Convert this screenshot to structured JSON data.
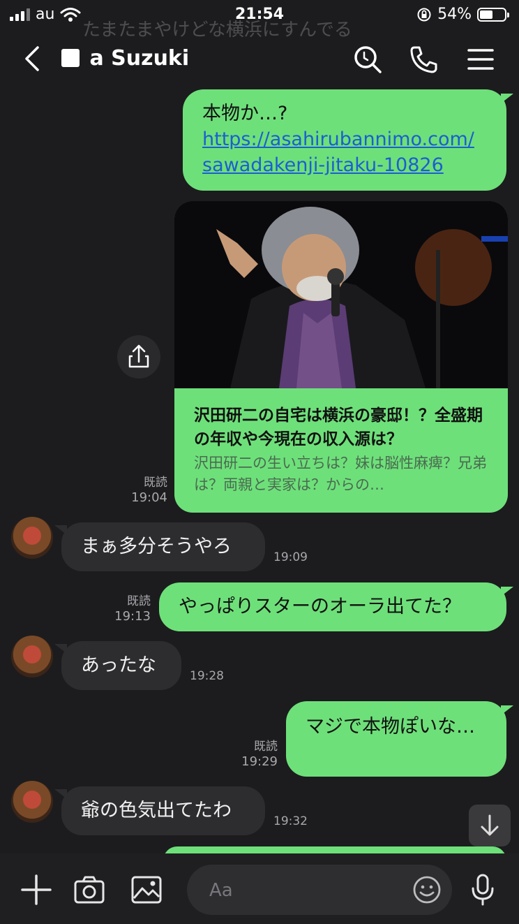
{
  "status_bar": {
    "carrier": "au",
    "time": "21:54",
    "battery": "54%",
    "battery_level": 0.54
  },
  "header": {
    "ghost_text": "たまたまやけどな横浜にすんでる",
    "contact_name": "a Suzuki"
  },
  "messages": [
    {
      "id": "m1",
      "direction": "out",
      "line1": "本物か…?",
      "link_line1": "https://asahirubannimo.com/",
      "link_line2": "sawadakenji-jitaku-10826"
    },
    {
      "id": "m2",
      "direction": "out",
      "type": "link-card",
      "card_title": "沢田研二の自宅は横浜の豪邸！？全盛期の年収や今現在の収入源は？",
      "card_desc": "沢田研二の生い立ちは？妹は脳性麻痺？兄弟は？両親と実家は？からの…",
      "read": "既読",
      "time": "19:04"
    },
    {
      "id": "m3",
      "direction": "in",
      "text": "まぁ多分そうやろ",
      "time": "19:09"
    },
    {
      "id": "m4",
      "direction": "out",
      "text": "やっぱりスターのオーラ出てた？",
      "read": "既読",
      "time": "19:13"
    },
    {
      "id": "m5",
      "direction": "in",
      "text": "あったな",
      "time": "19:28"
    },
    {
      "id": "m6",
      "direction": "out",
      "text": "マジで本物ぽいな…",
      "read": "既読",
      "time": "19:29"
    },
    {
      "id": "m7",
      "direction": "in",
      "text": "爺の色気出てたわ",
      "time": "19:32"
    }
  ],
  "input": {
    "placeholder": "Aa"
  },
  "icons": {
    "back": "chevron-left-icon",
    "search": "search-icon",
    "call": "phone-icon",
    "menu": "menu-icon",
    "share": "share-icon",
    "scroll": "arrow-down-icon",
    "plus": "plus-icon",
    "camera": "camera-icon",
    "image": "image-icon",
    "emoji": "emoji-icon",
    "mic": "mic-icon"
  },
  "colors": {
    "background": "#1c1c1e",
    "outgoing_bubble": "#6ee07a",
    "incoming_bubble": "#2d2d30",
    "link": "#1b5fd0"
  }
}
